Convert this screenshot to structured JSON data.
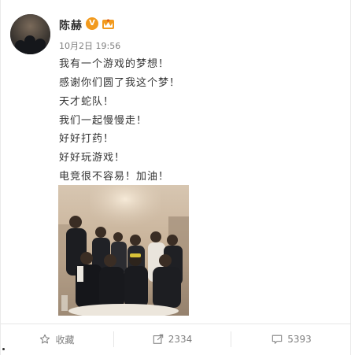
{
  "post": {
    "user_name": "陈赫",
    "verified_badge": "V",
    "time": "10月2日 19:56",
    "lines": [
      "我有一个游戏的梦想！",
      "感谢你们圆了我这个梦！",
      "天才蛇队！",
      "我们一起慢慢走！",
      "好好打药！",
      "好好玩游戏！",
      "电竞很不容易！加油！"
    ]
  },
  "actions": {
    "favorite_label": "收藏",
    "forward_count": "2334",
    "comment_count": "5393"
  },
  "colors": {
    "badge_orange": "#f29a1d",
    "text_primary": "#333333",
    "text_secondary": "#808080"
  },
  "icons": {
    "favorite": "star-icon",
    "forward": "forward-icon",
    "comment": "comment-icon",
    "verified": "verified-badge-icon",
    "vip": "vip-crown-icon"
  }
}
